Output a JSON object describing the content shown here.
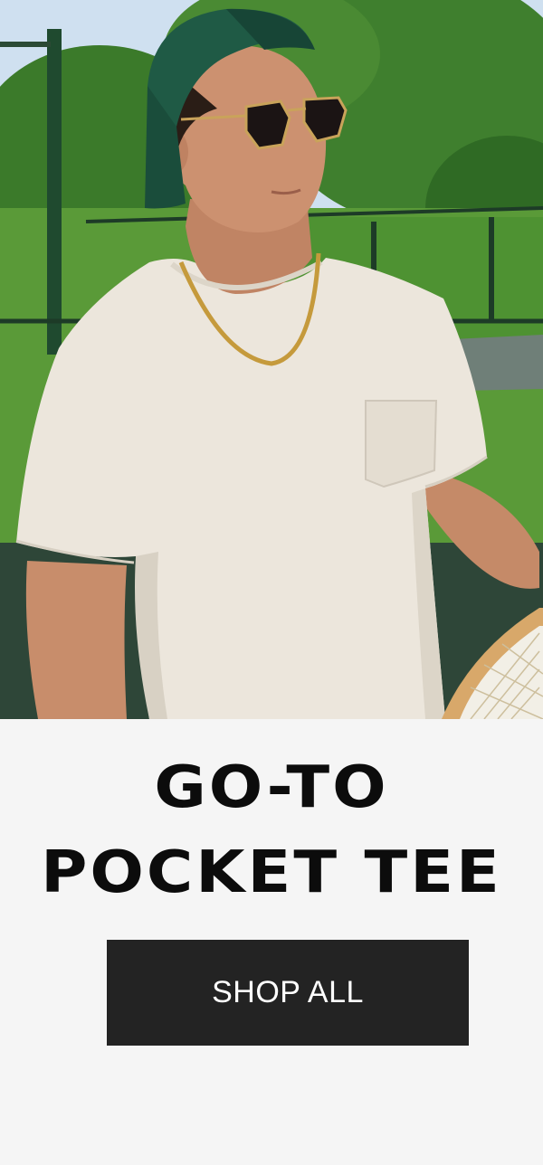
{
  "hero": {
    "image_semantic": "man-in-white-pocket-tee-on-tennis-court",
    "colors": {
      "sky": "#c9dcef",
      "foliage": "#3f7a2c",
      "grass": "#5c9a3a",
      "court": "#2f4a3a",
      "tee": "#ece6dc",
      "cap": "#1f5a45",
      "skin": "#c98d6c"
    }
  },
  "promo": {
    "headline_line1": "GO-TO",
    "headline_line2": "POCKET TEE",
    "cta_label": "SHOP ALL",
    "colors": {
      "background": "#f5f5f5",
      "headline": "#0c0c0c",
      "cta_background": "#232323",
      "cta_text": "#ffffff"
    }
  }
}
